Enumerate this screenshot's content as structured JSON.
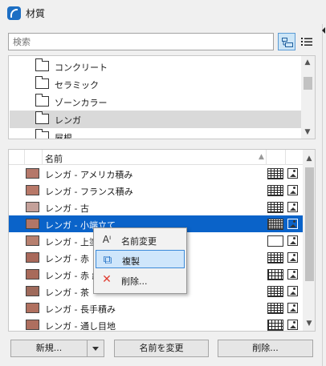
{
  "window": {
    "title": "材質"
  },
  "search": {
    "placeholder": "検索",
    "value": ""
  },
  "folders": [
    {
      "label": "コンクリート",
      "selected": false
    },
    {
      "label": "セラミック",
      "selected": false
    },
    {
      "label": "ゾーンカラー",
      "selected": false
    },
    {
      "label": "レンガ",
      "selected": true
    },
    {
      "label": "屋根",
      "selected": false
    }
  ],
  "list": {
    "header": {
      "name": "名前"
    },
    "rows": [
      {
        "label": "レンガ - アメリカ積み",
        "swatch": "#b5786a",
        "pattern": "brick",
        "selected": false
      },
      {
        "label": "レンガ - フランス積み",
        "swatch": "#b87868",
        "pattern": "brick",
        "selected": false
      },
      {
        "label": "レンガ - 古",
        "swatch": "#c4a19a",
        "pattern": "brick",
        "selected": false
      },
      {
        "label": "レンガ - 小端立て",
        "swatch": "#b27667",
        "pattern": "dense",
        "selected": true
      },
      {
        "label": "レンガ - 上塗",
        "swatch": "#b7806f",
        "pattern": "empty",
        "selected": false
      },
      {
        "label": "レンガ - 赤",
        "swatch": "#a9695b",
        "pattern": "brick",
        "selected": false
      },
      {
        "label": "レンガ - 赤 組",
        "swatch": "#a86a5a",
        "pattern": "grid",
        "selected": false
      },
      {
        "label": "レンガ - 茶",
        "swatch": "#9f6a5b",
        "pattern": "brick",
        "selected": false
      },
      {
        "label": "レンガ - 長手積み",
        "swatch": "#b0705f",
        "pattern": "brick",
        "selected": false
      },
      {
        "label": "レンガ - 通し目地",
        "swatch": "#ae6f5f",
        "pattern": "grid",
        "selected": false
      }
    ]
  },
  "context_menu": {
    "items": [
      {
        "label": "名前変更",
        "icon": "rename-icon",
        "glyph": "Aᴵ",
        "highlight": false
      },
      {
        "label": "複製",
        "icon": "duplicate-icon",
        "glyph": "⧉",
        "highlight": true
      },
      {
        "label": "削除...",
        "icon": "delete-icon",
        "glyph": "✕",
        "highlight": false
      }
    ]
  },
  "buttons": {
    "new": "新規...",
    "rename": "名前を変更",
    "delete": "削除..."
  },
  "colors": {
    "selection": "#0a63c9",
    "menu_highlight": "#cfe6fb",
    "delete_icon": "#e03c31",
    "duplicate_icon": "#1f6fc5"
  }
}
